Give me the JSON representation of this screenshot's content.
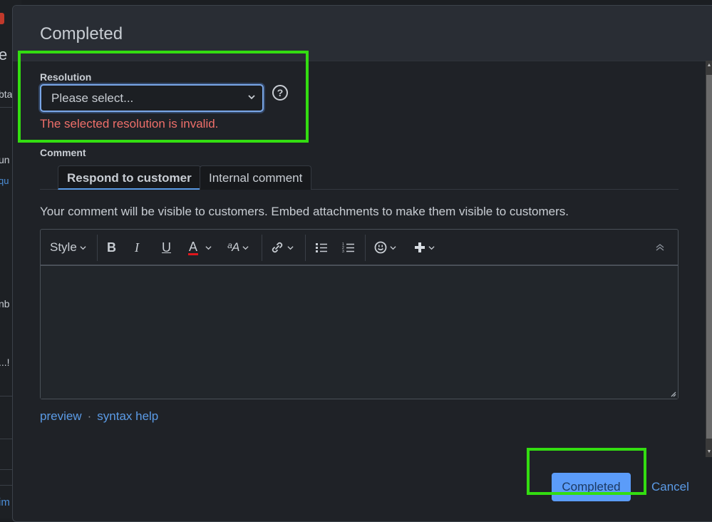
{
  "background": {
    "fragments": [
      "e",
      "bta",
      "un",
      "qu",
      "nb",
      "...!",
      "im"
    ]
  },
  "modal": {
    "title": "Completed",
    "resolution": {
      "label": "Resolution",
      "selected": "Please select...",
      "error": "The selected resolution is invalid.",
      "help_icon": "question-circle-icon"
    },
    "comment": {
      "label": "Comment",
      "tabs": [
        {
          "label": "Respond to customer",
          "active": true
        },
        {
          "label": "Internal comment",
          "active": false
        }
      ],
      "visibility_note": "Your comment will be visible to customers. Embed attachments to make them visible to customers.",
      "toolbar": {
        "style_label": "Style",
        "bold": "B",
        "italic": "I",
        "underline": "U",
        "text_color": "A",
        "text_color_accent": "#e0161b",
        "text_size": "ᵃA",
        "items": [
          "style-dropdown",
          "bold",
          "italic",
          "underline",
          "text-color",
          "text-size",
          "link",
          "bullet-list",
          "numbered-list",
          "emoji",
          "insert-more",
          "collapse-toolbar"
        ]
      },
      "body": ""
    },
    "links": {
      "preview": "preview",
      "separator": "·",
      "syntax_help": "syntax help"
    },
    "actions": {
      "submit": "Completed",
      "cancel": "Cancel"
    },
    "colors": {
      "accent": "#5b9cf9",
      "error": "#ef6f6a",
      "highlight": "#33dd11"
    }
  }
}
